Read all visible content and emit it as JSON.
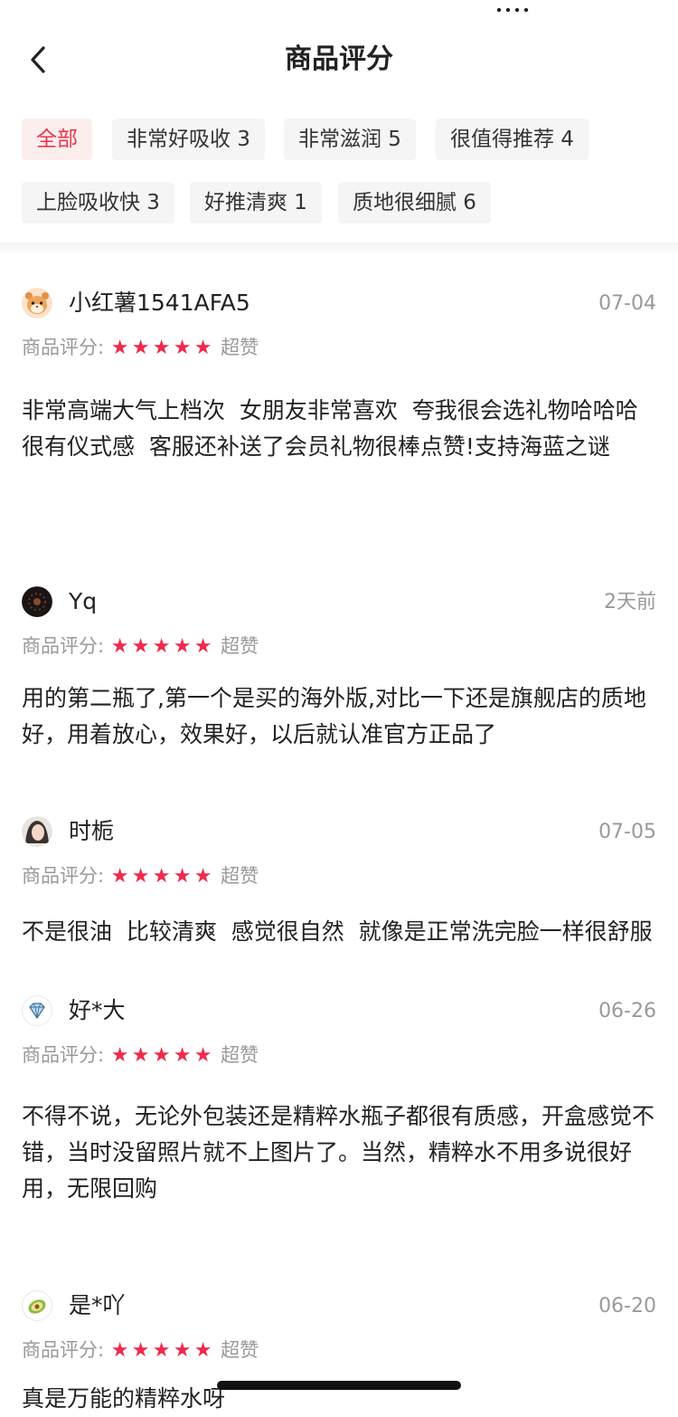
{
  "header": {
    "title": "商品评分",
    "back_icon": "chevron-left-icon"
  },
  "tags": [
    {
      "label": "全部",
      "active": true
    },
    {
      "label": "非常好吸收 3"
    },
    {
      "label": "非常滋润 5"
    },
    {
      "label": "很值得推荐 4"
    },
    {
      "label": "上脸吸收快 3"
    },
    {
      "label": "好推清爽 1"
    },
    {
      "label": "质地很细腻 6"
    }
  ],
  "rating_label": "商品评分:",
  "star_color": "#ee2b4b",
  "accent_color": "#e8364d",
  "reviews": [
    {
      "user": "小红薯1541AFA5",
      "date": "07-04",
      "rating_word": "超赞",
      "stars": 5,
      "body": "非常高端大气上档次  女朋友非常喜欢  夸我很会选礼物哈哈哈  很有仪式感  客服还补送了会员礼物很棒点赞!支持海蓝之谜",
      "avatar": "hamster-avatar-icon"
    },
    {
      "user": "Yq",
      "date": "2天前",
      "rating_word": "超赞",
      "stars": 5,
      "body": "用的第二瓶了,第一个是买的海外版,对比一下还是旗舰店的质地好，用着放心，效果好，以后就认准官方正品了",
      "avatar": "dark-photo-avatar"
    },
    {
      "user": "时栀",
      "date": "07-05",
      "rating_word": "超赞",
      "stars": 5,
      "body": "不是很油  比较清爽  感觉很自然  就像是正常洗完脸一样很舒服",
      "avatar": "portrait-avatar"
    },
    {
      "user": "好*大",
      "date": "06-26",
      "rating_word": "超赞",
      "stars": 5,
      "body": "不得不说，无论外包装还是精粹水瓶子都很有质感，开盒感觉不错，当时没留照片就不上图片了。当然，精粹水不用多说很好用，无限回购",
      "avatar": "diamond-avatar-icon"
    },
    {
      "user": "是*吖",
      "date": "06-20",
      "rating_word": "超赞",
      "stars": 5,
      "body": "真是万能的精粹水呀",
      "avatar": "avocado-avatar-icon"
    }
  ]
}
